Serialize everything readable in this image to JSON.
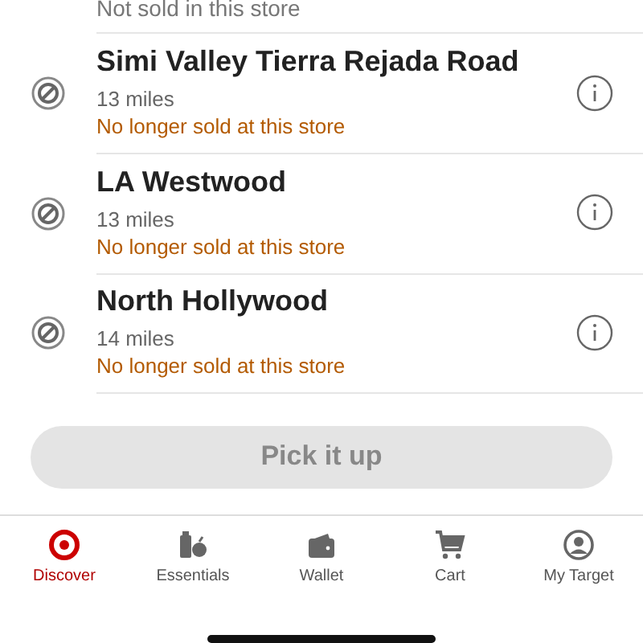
{
  "previous_status": "Not sold in this store",
  "stores": [
    {
      "name": "Simi Valley Tierra Rejada Road",
      "distance": "13 miles",
      "status": "No longer sold at this store",
      "available": false
    },
    {
      "name": "LA Westwood",
      "distance": "13 miles",
      "status": "No longer sold at this store",
      "available": false
    },
    {
      "name": "North Hollywood",
      "distance": "14 miles",
      "status": "No longer sold at this store",
      "available": false
    }
  ],
  "action_button": {
    "label": "Pick it up",
    "disabled": true
  },
  "tabs": [
    {
      "label": "Discover",
      "kind": "target",
      "selected": true
    },
    {
      "label": "Essentials",
      "kind": "essentials",
      "selected": false
    },
    {
      "label": "Wallet",
      "kind": "wallet",
      "selected": false
    },
    {
      "label": "Cart",
      "kind": "cart",
      "selected": false
    },
    {
      "label": "My Target",
      "kind": "profile",
      "selected": false
    }
  ]
}
